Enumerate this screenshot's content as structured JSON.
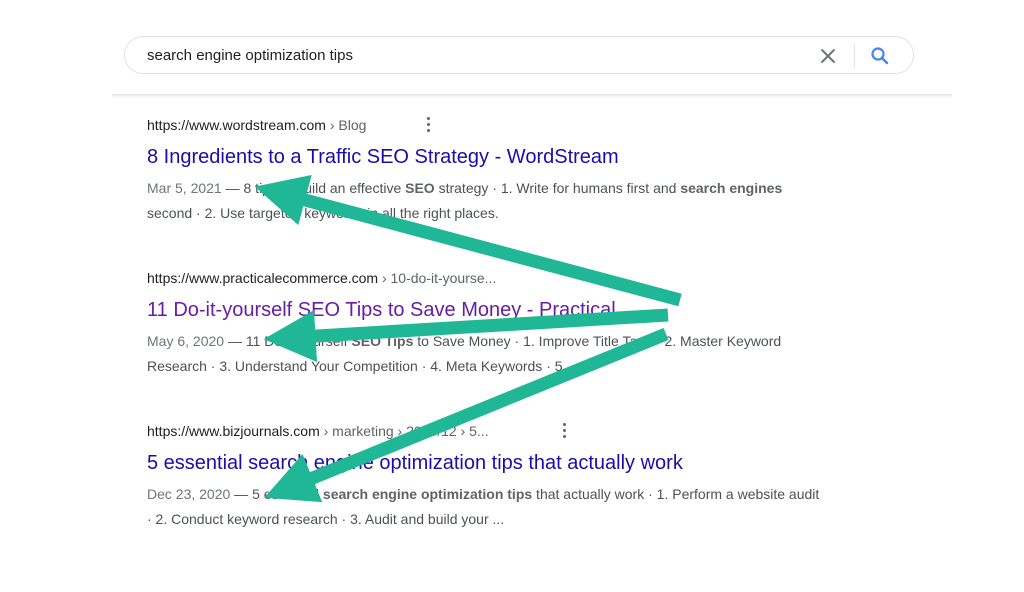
{
  "search": {
    "query": "search engine optimization tips",
    "clear_icon": "close-icon",
    "search_icon": "search-icon"
  },
  "results": [
    {
      "url": "https://www.wordstream.com",
      "path": " › Blog",
      "title": "8 Ingredients to a Traffic SEO Strategy - WordStream",
      "visited": false,
      "date": "Mar 5, 2021",
      "snippet_parts": [
        {
          "t": " — 8 tips to build an effective ",
          "b": false
        },
        {
          "t": "SEO",
          "b": true
        },
        {
          "t": " strategy · 1. Write for humans first and ",
          "b": false
        },
        {
          "t": "search engines",
          "b": true
        },
        {
          "t": " second · 2. Use targeted keywords in all the right places.",
          "b": false
        }
      ]
    },
    {
      "url": "https://www.practicalecommerce.com",
      "path": " › 10-do-it-yourse...",
      "title": "11 Do-it-yourself SEO Tips to Save Money - Practical ...",
      "visited": true,
      "date": "May 6, 2020",
      "snippet_parts": [
        {
          "t": " — 11 Do-it-yourself ",
          "b": false
        },
        {
          "t": "SEO Tips",
          "b": true
        },
        {
          "t": " to Save Money · 1. Improve Title Tags · 2. Master Keyword Research · 3. Understand Your Competition · 4. Meta Keywords · 5.",
          "b": false
        }
      ]
    },
    {
      "url": "https://www.bizjournals.com",
      "path": " › marketing › 2020/12 › 5...",
      "title": "5 essential search engine optimization tips that actually work",
      "visited": false,
      "date": "Dec 23, 2020",
      "snippet_parts": [
        {
          "t": " — 5 essential ",
          "b": false
        },
        {
          "t": "search engine optimization tips",
          "b": true
        },
        {
          "t": " that actually work · 1. Perform a website audit · 2. Conduct keyword research · 3. Audit and build your ...",
          "b": false
        }
      ]
    }
  ],
  "colors": {
    "link": "#1a0dab",
    "visited": "#681da8",
    "arrow": "#1fb795",
    "search_blue": "#4285f4"
  }
}
